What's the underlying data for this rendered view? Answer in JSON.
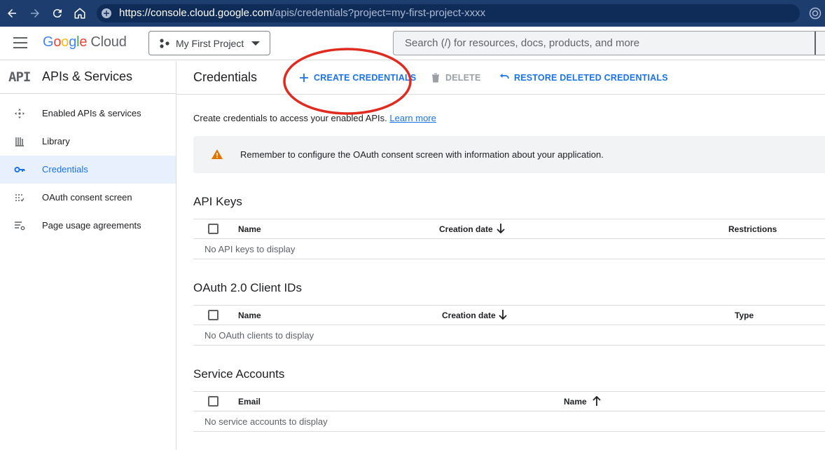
{
  "browser": {
    "url_host": "https://console.cloud.google.com",
    "url_path": "/apis/credentials?project=my-first-project-xxxx"
  },
  "header": {
    "logo_google": "Google",
    "logo_cloud": "Cloud",
    "project_label": "My First Project",
    "search_placeholder": "Search (/) for resources, docs, products, and more"
  },
  "sidebar": {
    "badge": "API",
    "title": "APIs & Services",
    "items": [
      {
        "label": "Enabled APIs & services",
        "icon": "apis-icon",
        "active": false
      },
      {
        "label": "Library",
        "icon": "library-icon",
        "active": false
      },
      {
        "label": "Credentials",
        "icon": "key-icon",
        "active": true
      },
      {
        "label": "OAuth consent screen",
        "icon": "consent-icon",
        "active": false
      },
      {
        "label": "Page usage agreements",
        "icon": "settings-list-icon",
        "active": false
      }
    ]
  },
  "toolbar": {
    "title": "Credentials",
    "create_label": "CREATE CREDENTIALS",
    "delete_label": "DELETE",
    "restore_label": "RESTORE DELETED CREDENTIALS"
  },
  "intro": {
    "text": "Create credentials to access your enabled APIs.",
    "link": "Learn more"
  },
  "notice": {
    "text": "Remember to configure the OAuth consent screen with information about your application."
  },
  "sections": {
    "api_keys": {
      "title": "API Keys",
      "columns": [
        "Name",
        "Creation date",
        "Restrictions"
      ],
      "empty": "No API keys to display"
    },
    "oauth": {
      "title": "OAuth 2.0 Client IDs",
      "columns": [
        "Name",
        "Creation date",
        "Type"
      ],
      "empty": "No OAuth clients to display"
    },
    "service_accounts": {
      "title": "Service Accounts",
      "columns": [
        "Email",
        "Name"
      ],
      "empty": "No service accounts to display"
    }
  },
  "colors": {
    "accent": "#1a73e8",
    "annotation": "#e02b20",
    "browser_bar": "#1c3d6e",
    "warning": "#e37400"
  }
}
